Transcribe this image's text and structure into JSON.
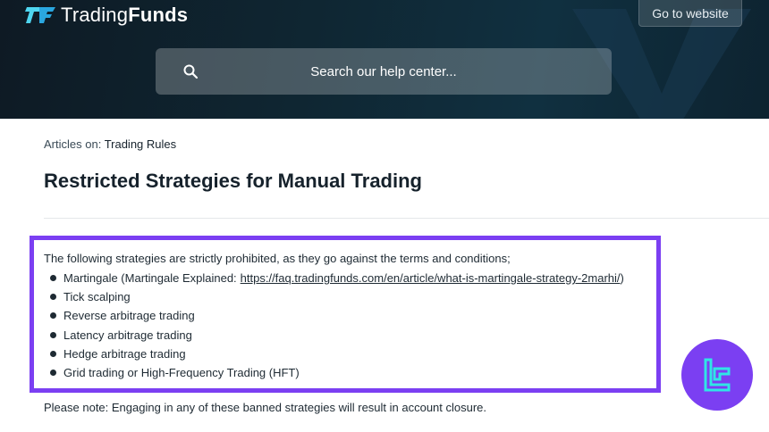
{
  "header": {
    "logo_prefix": "Trading",
    "logo_bold": "Funds",
    "site_button": "Go to website",
    "search_placeholder": "Search our help center..."
  },
  "breadcrumb": {
    "prefix": "Articles on: ",
    "link": "Trading Rules"
  },
  "article": {
    "title": "Restricted Strategies for Manual Trading",
    "intro": "The following strategies are strictly prohibited, as they go against the terms and conditions;",
    "items": [
      {
        "label": "Martingale (Martingale Explained: ",
        "link": "https://faq.tradingfunds.com/en/article/what-is-martingale-strategy-2marhi/",
        "suffix": " )"
      },
      {
        "label": "Tick scalping"
      },
      {
        "label": "Reverse arbitrage trading"
      },
      {
        "label": "Latency arbitrage trading"
      },
      {
        "label": "Hedge arbitrage trading"
      },
      {
        "label": "Grid trading or High-Frequency Trading (HFT)"
      }
    ],
    "note": "Please note: Engaging in any of these banned strategies will result in account closure."
  },
  "colors": {
    "highlight": "#7b3ff2",
    "header_bg": "#0f2632",
    "badge_icon": "#2fe6e6"
  },
  "icons": [
    "logo-icon",
    "search-icon",
    "chevron-watermark",
    "badge-logo-icon"
  ]
}
